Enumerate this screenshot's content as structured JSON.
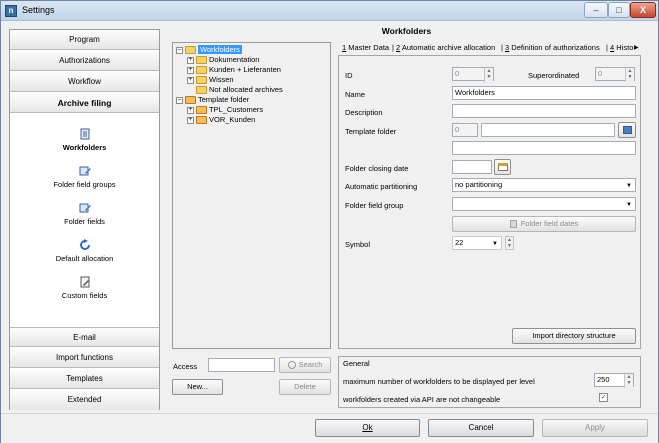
{
  "window": {
    "title": "Settings",
    "minimize": "–",
    "maximize": "□",
    "close": "X"
  },
  "nav": {
    "top_items": [
      {
        "label": "Program"
      },
      {
        "label": "Authorizations"
      },
      {
        "label": "Workflow"
      },
      {
        "label": "Archive filing"
      }
    ],
    "sub_items": [
      {
        "label": "Workfolders"
      },
      {
        "label": "Folder field groups"
      },
      {
        "label": "Folder fields"
      },
      {
        "label": "Default allocation"
      },
      {
        "label": "Custom fields"
      }
    ],
    "bottom_items": [
      {
        "label": "E-mail"
      },
      {
        "label": "Import functions"
      },
      {
        "label": "Templates"
      },
      {
        "label": "Extended"
      }
    ]
  },
  "content": {
    "title": "Workfolders",
    "tree": [
      {
        "label": "Workfolders",
        "expander": "–"
      },
      {
        "label": "Dokumentation",
        "expander": "+"
      },
      {
        "label": "Kunden + Lieferanten",
        "expander": "+"
      },
      {
        "label": "Wissen",
        "expander": "+"
      },
      {
        "label": "Not allocated archives",
        "expander": ""
      },
      {
        "label": "Template folder",
        "expander": "–"
      },
      {
        "label": "TPL_Customers",
        "expander": "+"
      },
      {
        "label": "VOR_Kunden",
        "expander": "+"
      }
    ],
    "access_label": "Access",
    "search_label": "Search",
    "new_button": "New...",
    "delete_button": "Delete",
    "tabs": [
      {
        "num": "1",
        "label": " Master Data"
      },
      {
        "num": "2",
        "label": " Automatic archive allocation"
      },
      {
        "num": "3",
        "label": " Definition of authorizations"
      },
      {
        "num": "4",
        "label": " Histo"
      }
    ],
    "tab_scroll": "▶",
    "form": {
      "id_label": "ID",
      "id_value": "0",
      "superordinated_label": "Superordinated",
      "superordinated_value": "0",
      "name_label": "Name",
      "name_value": "Workfolders",
      "description_label": "Description",
      "description_value": "",
      "template_folder_label": "Template folder",
      "template_folder_value": "0",
      "folder_closing_date_label": "Folder closing date",
      "automatic_partitioning_label": "Automatic partitioning",
      "automatic_partitioning_value": "no partitioning",
      "folder_field_group_label": "Folder field group",
      "folder_field_group_value": "",
      "folder_field_dates_button": "Folder field dates",
      "symbol_label": "Symbol",
      "symbol_value": "22",
      "import_button": "Import directory structure"
    },
    "general": {
      "title": "General",
      "max_label": "maximum number of workfolders to be displayed per level",
      "max_value": "250",
      "api_label": "workfolders created via API are not changeable",
      "api_checked": "✓"
    }
  },
  "footer": {
    "ok": "Ok",
    "cancel": "Cancel",
    "apply": "Apply"
  }
}
